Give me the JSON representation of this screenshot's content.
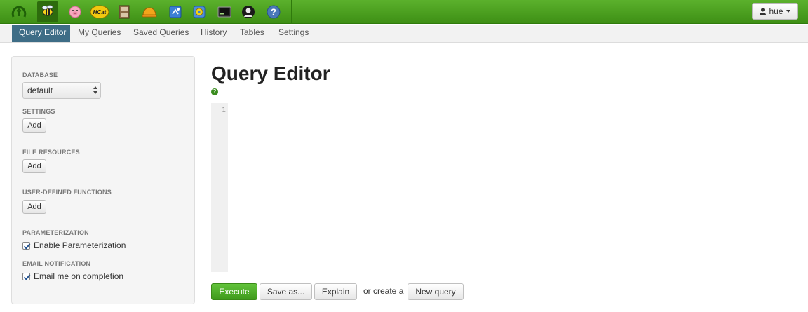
{
  "topbar": {
    "apps": [
      {
        "name": "hue-logo-icon"
      },
      {
        "name": "beeswax-icon",
        "active": true
      },
      {
        "name": "pig-icon"
      },
      {
        "name": "hcatalog-icon",
        "text": "HCat"
      },
      {
        "name": "file-browser-icon"
      },
      {
        "name": "job-designer-icon"
      },
      {
        "name": "job-browser-icon"
      },
      {
        "name": "oozie-icon"
      },
      {
        "name": "shell-icon"
      },
      {
        "name": "user-admin-icon"
      },
      {
        "name": "help-icon"
      }
    ],
    "user_label": "hue",
    "colors": {
      "bar": "#4ea323",
      "active": "#2d6b0d"
    }
  },
  "subnav": {
    "tabs": [
      {
        "label": "Query Editor",
        "active": true
      },
      {
        "label": "My Queries"
      },
      {
        "label": "Saved Queries"
      },
      {
        "label": "History"
      },
      {
        "label": "Tables"
      },
      {
        "label": "Settings"
      }
    ],
    "active_color": "#3e6d86"
  },
  "sidebar": {
    "database_label": "DATABASE",
    "database_value": "default",
    "settings_label": "SETTINGS",
    "settings_add": "Add",
    "file_resources_label": "FILE RESOURCES",
    "file_resources_add": "Add",
    "udf_label": "USER-DEFINED FUNCTIONS",
    "udf_add": "Add",
    "parameterization_label": "PARAMETERIZATION",
    "parameterization_check": "Enable Parameterization",
    "email_label": "EMAIL NOTIFICATION",
    "email_check": "Email me on completion"
  },
  "main": {
    "title": "Query Editor",
    "help_glyph": "?",
    "line_number": "1",
    "execute_label": "Execute",
    "save_as_label": "Save as...",
    "explain_label": "Explain",
    "or_create_text": "or create a",
    "new_query_label": "New query",
    "primary_color": "#4fae28"
  }
}
